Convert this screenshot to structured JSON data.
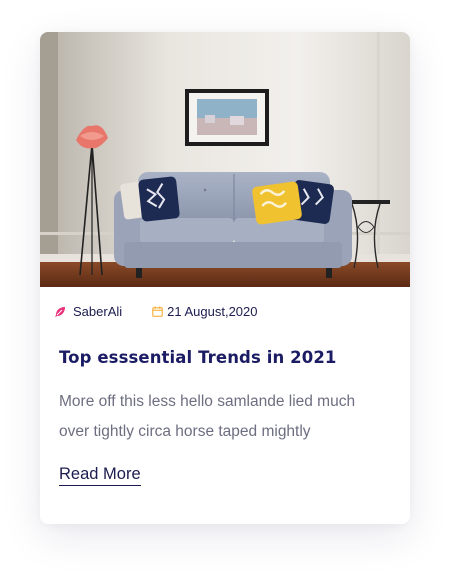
{
  "post": {
    "author": "SaberAli",
    "date": "21 August,2020",
    "title": "Top esssential Trends in 2021",
    "excerpt": "More off this less hello samlande lied much over tightly circa horse taped mightly",
    "read_more_label": "Read More"
  },
  "icons": {
    "author": "feather-icon",
    "date": "calendar-icon"
  },
  "colors": {
    "title": "#1b1c63",
    "text": "#6d6e80",
    "author_icon": "#e8317a",
    "date_icon": "#f5a623"
  }
}
